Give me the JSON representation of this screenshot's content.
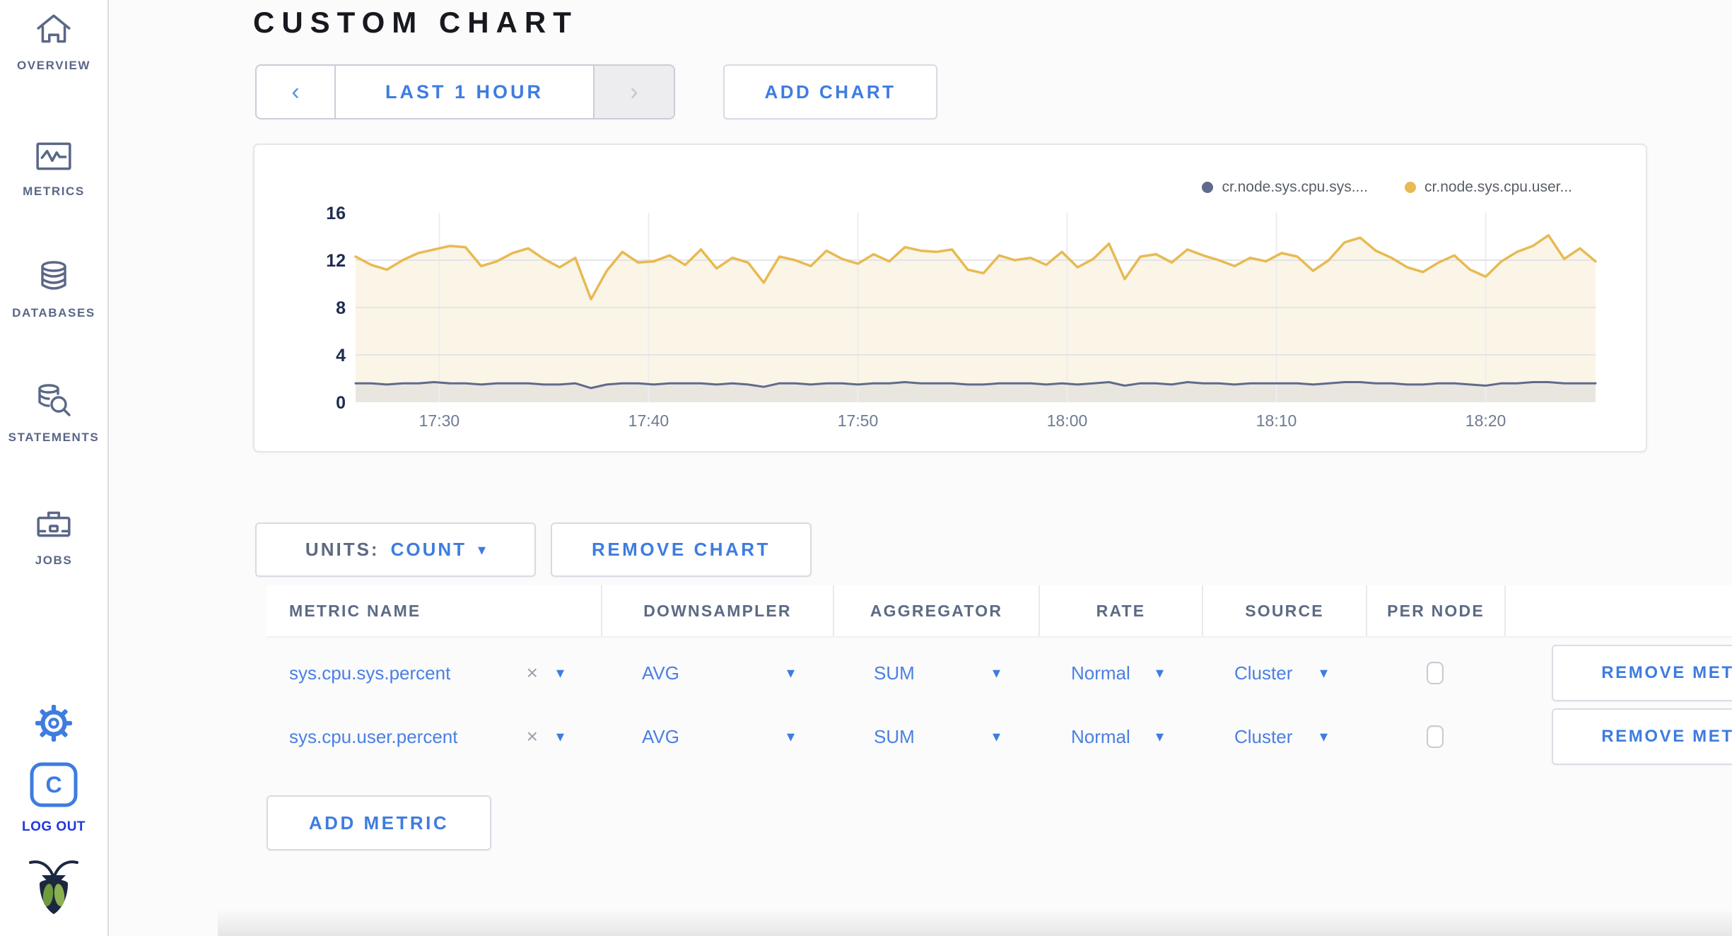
{
  "header": {
    "title": "CUSTOM CHART"
  },
  "sidebar": {
    "items": [
      {
        "label": "OVERVIEW",
        "icon": "home-icon"
      },
      {
        "label": "METRICS",
        "icon": "metrics-icon"
      },
      {
        "label": "DATABASES",
        "icon": "database-icon"
      },
      {
        "label": "STATEMENTS",
        "icon": "statements-icon"
      },
      {
        "label": "JOBS",
        "icon": "jobs-icon"
      }
    ],
    "logout_label": "LOG OUT"
  },
  "toolbar": {
    "prev_label": "‹",
    "time_range_label": "LAST 1 HOUR",
    "next_label": "›",
    "add_chart_label": "ADD CHART"
  },
  "chart_controls": {
    "units_label": "UNITS:",
    "units_value": "COUNT",
    "remove_chart_label": "REMOVE CHART",
    "add_metric_label": "ADD METRIC"
  },
  "icons": {
    "dropdown_arrow": "▾",
    "clear_x": "×"
  },
  "metrics_table": {
    "columns": [
      "METRIC NAME",
      "DOWNSAMPLER",
      "AGGREGATOR",
      "RATE",
      "SOURCE",
      "PER NODE"
    ],
    "rows": [
      {
        "metric_name": "sys.cpu.sys.percent",
        "downsampler": "AVG",
        "aggregator": "SUM",
        "rate": "Normal",
        "source": "Cluster",
        "per_node_checked": false,
        "remove_label": "REMOVE METRIC"
      },
      {
        "metric_name": "sys.cpu.user.percent",
        "downsampler": "AVG",
        "aggregator": "SUM",
        "rate": "Normal",
        "source": "Cluster",
        "per_node_checked": false,
        "remove_label": "REMOVE METRIC"
      }
    ]
  },
  "chart_data": {
    "type": "line",
    "title": "",
    "xlabel": "",
    "ylabel": "",
    "ylim": [
      0,
      16
    ],
    "y_ticks": [
      0,
      4,
      8,
      12,
      16
    ],
    "y_gridlines": [
      4,
      8,
      12
    ],
    "x_minutes_span": 59.25,
    "x_ticks": [
      {
        "label": "17:30",
        "minute": 4
      },
      {
        "label": "17:40",
        "minute": 14
      },
      {
        "label": "17:50",
        "minute": 24
      },
      {
        "label": "18:00",
        "minute": 34
      },
      {
        "label": "18:10",
        "minute": 44
      },
      {
        "label": "18:20",
        "minute": 54
      }
    ],
    "grid": true,
    "legend_position": "top-right",
    "series": [
      {
        "name": "cr.node.sys.cpu.sys....",
        "color": "#5e6b8c",
        "fill": "#e9e6df",
        "line_width": 3,
        "values": [
          1.6,
          1.6,
          1.5,
          1.6,
          1.6,
          1.7,
          1.6,
          1.6,
          1.5,
          1.6,
          1.6,
          1.6,
          1.5,
          1.5,
          1.6,
          1.2,
          1.5,
          1.6,
          1.6,
          1.5,
          1.6,
          1.6,
          1.6,
          1.5,
          1.6,
          1.5,
          1.3,
          1.6,
          1.6,
          1.5,
          1.6,
          1.6,
          1.5,
          1.6,
          1.6,
          1.7,
          1.6,
          1.6,
          1.6,
          1.5,
          1.5,
          1.6,
          1.6,
          1.6,
          1.5,
          1.6,
          1.5,
          1.6,
          1.7,
          1.4,
          1.6,
          1.6,
          1.5,
          1.7,
          1.6,
          1.6,
          1.5,
          1.6,
          1.6,
          1.6,
          1.6,
          1.5,
          1.6,
          1.7,
          1.7,
          1.6,
          1.6,
          1.5,
          1.5,
          1.6,
          1.6,
          1.5,
          1.4,
          1.6,
          1.6,
          1.7,
          1.7,
          1.6,
          1.6,
          1.6
        ]
      },
      {
        "name": "cr.node.sys.cpu.user...",
        "color": "#e7ba52",
        "fill": "#faf5e7",
        "line_width": 3.5,
        "values": [
          12.3,
          11.6,
          11.2,
          12.0,
          12.6,
          12.9,
          13.2,
          13.1,
          11.5,
          11.9,
          12.6,
          13.0,
          12.1,
          11.4,
          12.2,
          8.7,
          11.1,
          12.7,
          11.8,
          11.9,
          12.4,
          11.6,
          12.9,
          11.3,
          12.2,
          11.8,
          10.1,
          12.3,
          12.0,
          11.5,
          12.8,
          12.1,
          11.7,
          12.5,
          11.9,
          13.1,
          12.8,
          12.7,
          12.9,
          11.2,
          10.9,
          12.4,
          12.0,
          12.2,
          11.6,
          12.7,
          11.4,
          12.1,
          13.4,
          10.4,
          12.3,
          12.5,
          11.8,
          12.9,
          12.4,
          12.0,
          11.5,
          12.2,
          11.9,
          12.6,
          12.3,
          11.1,
          12.0,
          13.5,
          13.9,
          12.8,
          12.2,
          11.4,
          11.0,
          11.8,
          12.4,
          11.2,
          10.6,
          11.9,
          12.7,
          13.2,
          14.1,
          12.1,
          13.0,
          11.9
        ]
      }
    ]
  }
}
